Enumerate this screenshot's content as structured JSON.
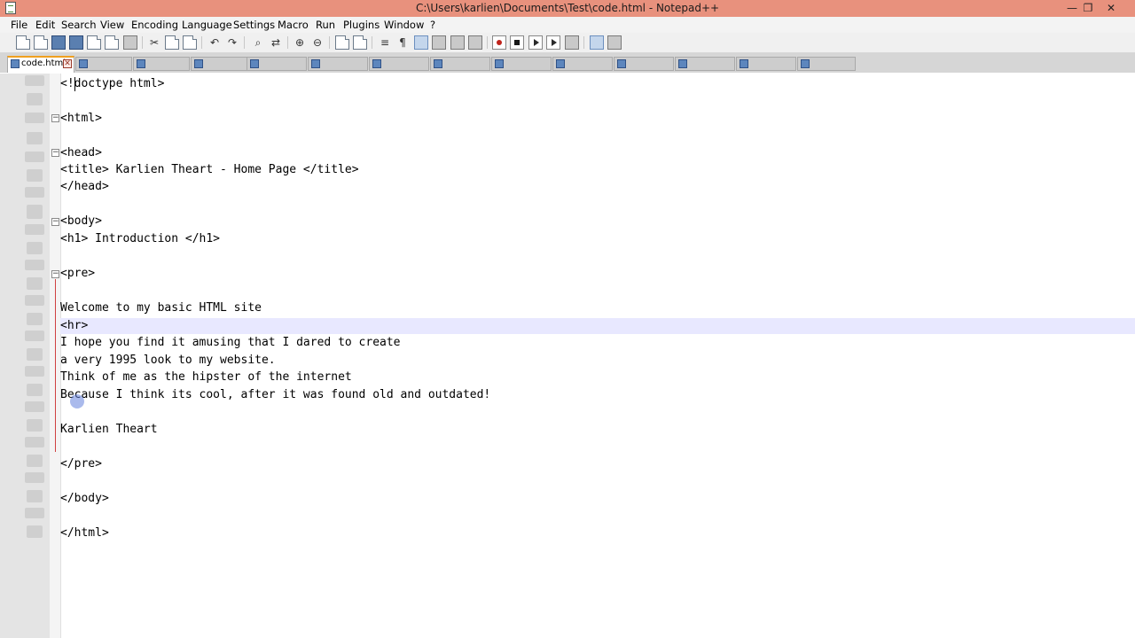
{
  "window": {
    "title": "C:\\Users\\karlien\\Documents\\Test\\code.html - Notepad++",
    "controls": {
      "minimize": "—",
      "maximize": "❐",
      "close": "✕"
    }
  },
  "menu": [
    "File",
    "Edit",
    "Search",
    "View",
    "Encoding",
    "Language",
    "Settings",
    "Macro",
    "Run",
    "Plugins",
    "Window",
    "?"
  ],
  "toolbar": {
    "icons": [
      "new-file-icon",
      "open-file-icon",
      "save-icon",
      "save-all-icon",
      "close-icon",
      "close-all-icon",
      "print-icon",
      "cut-icon",
      "copy-icon",
      "paste-icon",
      "undo-icon",
      "redo-icon",
      "find-icon",
      "replace-icon",
      "zoom-in-icon",
      "zoom-out-icon",
      "sync-vertical-icon",
      "sync-horizontal-icon",
      "word-wrap-icon",
      "show-all-chars-icon",
      "indent-guide-icon",
      "doc-map-icon",
      "function-list-icon",
      "folder-workspace-icon",
      "macro-record-icon",
      "macro-stop-icon",
      "macro-play-icon",
      "macro-run-multiple-icon",
      "macro-save-icon",
      "spell-check-icon",
      "hex-icon"
    ]
  },
  "tabs": {
    "active": {
      "label": "code.html"
    },
    "inactive_count": 13
  },
  "editor": {
    "lines": [
      "<!doctype html>",
      "",
      "<html>",
      "",
      "<head>",
      "<title> Karlien Theart - Home Page </title>",
      "</head>",
      "",
      "<body>",
      "<h1> Introduction </h1>",
      "",
      "<pre>",
      "",
      "Welcome to my basic HTML site",
      "<hr>",
      "I hope you find it amusing that I dared to create",
      "a very 1995 look to my website.",
      "Think of me as the hipster of the internet",
      "Because I think its cool, after it was found old and outdated!",
      "",
      "Karlien Theart",
      "",
      "</pre>",
      "",
      "</body>",
      "",
      "</html>"
    ]
  },
  "colors": {
    "titlebar": "#e8917d",
    "current_line": "#e8e8ff",
    "tab_active_accent": "#f0a020"
  }
}
